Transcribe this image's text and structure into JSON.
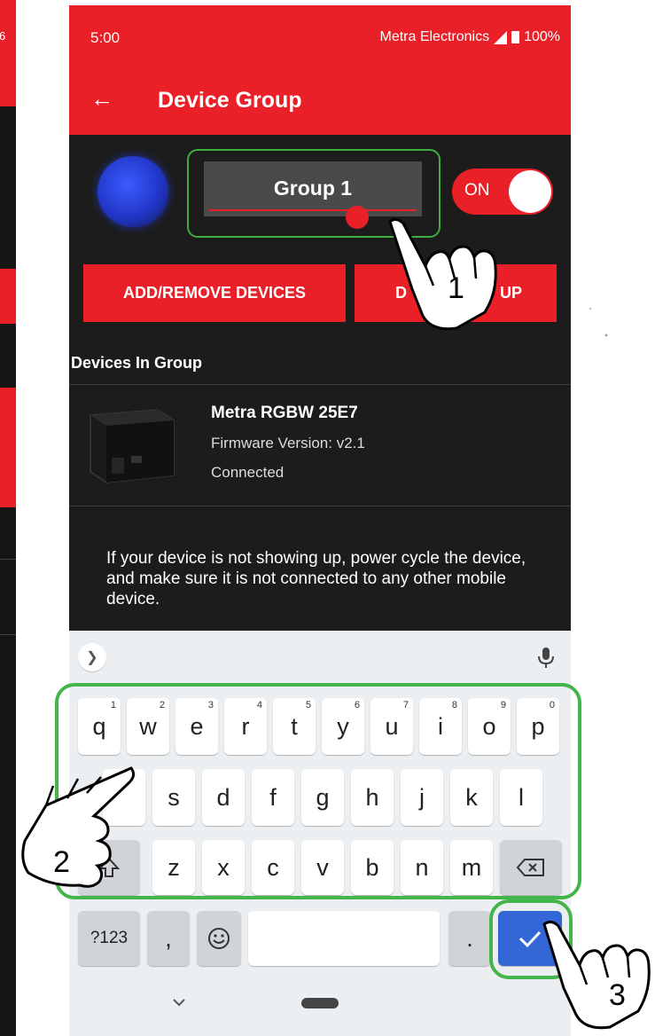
{
  "status_bar": {
    "time": "5:00",
    "carrier": "Metra Electronics",
    "battery": "100%",
    "left_partial_battery": "6"
  },
  "app_bar": {
    "title": "Device Group",
    "back_icon": "arrow-left-icon"
  },
  "group": {
    "name": "Group 1",
    "toggle_label": "ON",
    "toggle_on": true,
    "indicator_color": "#2b44e0"
  },
  "buttons": {
    "add_remove": "ADD/REMOVE DEVICES",
    "delete_partial_left": "D",
    "delete_partial_right": "UP"
  },
  "devices_section": {
    "title": "Devices In Group",
    "items": [
      {
        "name": "Metra RGBW 25E7",
        "firmware": "Firmware Version: v2.1",
        "status": "Connected"
      }
    ]
  },
  "help_text": "If your device is not showing up, power cycle the device, and make sure it is not connected to any other mobile device.",
  "keyboard": {
    "row1": [
      {
        "key": "q",
        "hint": "1"
      },
      {
        "key": "w",
        "hint": "2"
      },
      {
        "key": "e",
        "hint": "3"
      },
      {
        "key": "r",
        "hint": "4"
      },
      {
        "key": "t",
        "hint": "5"
      },
      {
        "key": "y",
        "hint": "6"
      },
      {
        "key": "u",
        "hint": "7"
      },
      {
        "key": "i",
        "hint": "8"
      },
      {
        "key": "o",
        "hint": "9"
      },
      {
        "key": "p",
        "hint": "0"
      }
    ],
    "row2": [
      "s",
      "d",
      "f",
      "g",
      "h",
      "j",
      "k",
      "l"
    ],
    "row3": [
      "z",
      "x",
      "c",
      "v",
      "b",
      "n",
      "m"
    ],
    "symbols_key": "?123",
    "comma_key": ",",
    "period_key": ".",
    "emoji_icon": "smiley-icon",
    "enter_icon": "checkmark-icon",
    "backspace_icon": "backspace-icon",
    "shift_icon": "shift-arrow-icon",
    "mic_icon": "microphone-icon",
    "expand_icon": "chevron-right-icon",
    "collapse_icon": "chevron-down-icon"
  },
  "annotations": {
    "step1": "1",
    "step2": "2",
    "step3": "3",
    "highlight_color": "#43b54a"
  },
  "colors": {
    "brand_red": "#e92027",
    "enter_blue": "#3367d6",
    "background_dark": "#1c1c1c"
  }
}
